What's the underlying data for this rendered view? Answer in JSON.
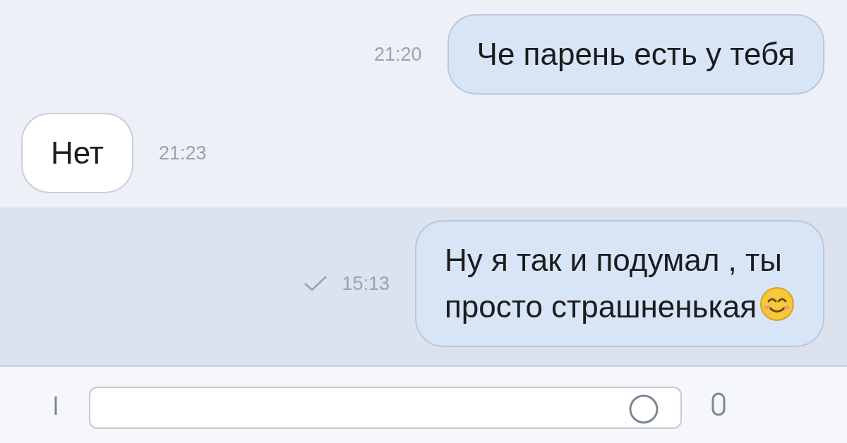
{
  "messages": [
    {
      "kind": "outgoing",
      "lines": [
        "Че парень есть у тебя"
      ],
      "time": "21:20",
      "unread": false,
      "sent_mark": false,
      "emoji": false
    },
    {
      "kind": "incoming",
      "lines": [
        "Нет"
      ],
      "time": "21:23",
      "unread": false,
      "sent_mark": false,
      "emoji": false
    },
    {
      "kind": "outgoing",
      "lines": [
        "Ну я так и подумал , ты",
        "просто страшненькая"
      ],
      "time": "15:13",
      "unread": true,
      "sent_mark": true,
      "emoji": true
    }
  ]
}
